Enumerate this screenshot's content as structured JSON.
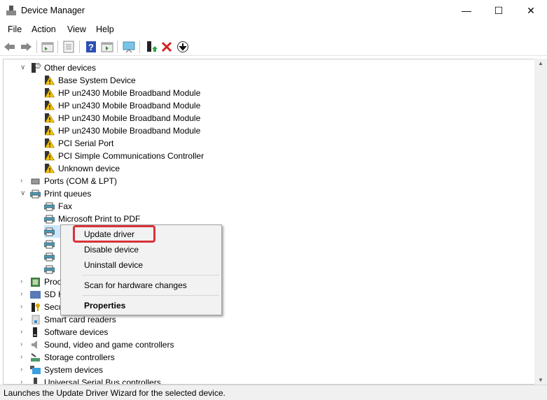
{
  "window": {
    "title": "Device Manager",
    "min": "—",
    "max": "☐",
    "close": "✕"
  },
  "menu": [
    "File",
    "Action",
    "View",
    "Help"
  ],
  "toolbar": [
    "back",
    "forward",
    "properties-pane",
    "details",
    "help",
    "run",
    "scan-monitor",
    "update-driver",
    "uninstall",
    "download"
  ],
  "tree": [
    {
      "label": "Other devices",
      "level": 0,
      "exp": "v",
      "icon": "other"
    },
    {
      "label": "Base System Device",
      "level": 1,
      "icon": "warn"
    },
    {
      "label": "HP un2430 Mobile Broadband Module",
      "level": 1,
      "icon": "warn"
    },
    {
      "label": "HP un2430 Mobile Broadband Module",
      "level": 1,
      "icon": "warn"
    },
    {
      "label": "HP un2430 Mobile Broadband Module",
      "level": 1,
      "icon": "warn"
    },
    {
      "label": "HP un2430 Mobile Broadband Module",
      "level": 1,
      "icon": "warn"
    },
    {
      "label": "PCI Serial Port",
      "level": 1,
      "icon": "warn"
    },
    {
      "label": "PCI Simple Communications Controller",
      "level": 1,
      "icon": "warn"
    },
    {
      "label": "Unknown device",
      "level": 1,
      "icon": "warn"
    },
    {
      "label": "Ports (COM & LPT)",
      "level": 0,
      "exp": ">",
      "icon": "port"
    },
    {
      "label": "Print queues",
      "level": 0,
      "exp": "v",
      "icon": "printer"
    },
    {
      "label": "Fax",
      "level": 1,
      "icon": "printer"
    },
    {
      "label": "Microsoft Print to PDF",
      "level": 1,
      "icon": "printer"
    },
    {
      "label": "",
      "level": 1,
      "icon": "printer",
      "selected": true
    },
    {
      "label": "",
      "level": 1,
      "icon": "printer"
    },
    {
      "label": "",
      "level": 1,
      "icon": "printer"
    },
    {
      "label": "",
      "level": 1,
      "icon": "printer"
    },
    {
      "label": "Proc",
      "level": 0,
      "exp": ">",
      "icon": "cpu"
    },
    {
      "label": "SD H",
      "level": 0,
      "exp": ">",
      "icon": "sd"
    },
    {
      "label": "Secu",
      "level": 0,
      "exp": ">",
      "icon": "security"
    },
    {
      "label": "Smart card readers",
      "level": 0,
      "exp": ">",
      "icon": "smartcard"
    },
    {
      "label": "Software devices",
      "level": 0,
      "exp": ">",
      "icon": "software"
    },
    {
      "label": "Sound, video and game controllers",
      "level": 0,
      "exp": ">",
      "icon": "sound"
    },
    {
      "label": "Storage controllers",
      "level": 0,
      "exp": ">",
      "icon": "storage"
    },
    {
      "label": "System devices",
      "level": 0,
      "exp": ">",
      "icon": "system"
    },
    {
      "label": "Universal Serial Bus controllers",
      "level": 0,
      "exp": ">",
      "icon": "usb"
    }
  ],
  "context_menu": {
    "update": "Update driver",
    "disable": "Disable device",
    "uninstall": "Uninstall device",
    "scan": "Scan for hardware changes",
    "properties": "Properties"
  },
  "status": "Launches the Update Driver Wizard for the selected device.",
  "colors": {
    "highlight": "#d9323a",
    "selection": "#cce8ff"
  }
}
